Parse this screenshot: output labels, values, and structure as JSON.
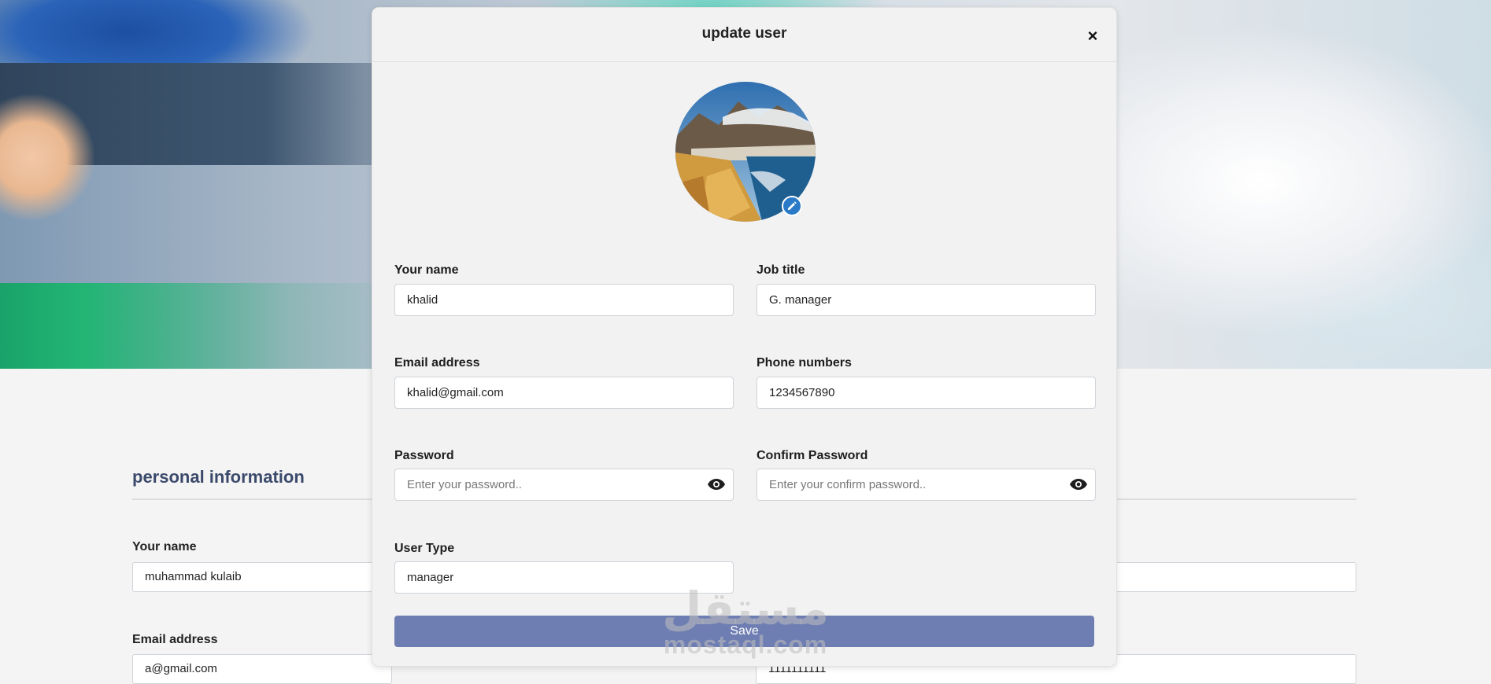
{
  "background": {
    "section_title": "personal information",
    "name_label": "Your name",
    "name_value": "muhammad kulaib",
    "email_label": "Email address",
    "email_value": "a@gmail.com",
    "phone_value": "1111111111"
  },
  "modal": {
    "title": "update user",
    "close_label": "×",
    "fields": {
      "name": {
        "label": "Your name",
        "value": "khalid"
      },
      "job_title": {
        "label": "Job title",
        "value": "G. manager"
      },
      "email": {
        "label": "Email address",
        "value": "khalid@gmail.com"
      },
      "phone": {
        "label": "Phone numbers",
        "value": "1234567890"
      },
      "password": {
        "label": "Password",
        "placeholder": "Enter your password.."
      },
      "confirm_password": {
        "label": "Confirm Password",
        "placeholder": "Enter your confirm password.."
      },
      "user_type": {
        "label": "User Type",
        "value": "manager"
      }
    },
    "save_label": "Save"
  },
  "watermark": {
    "latin": "mostaql.com",
    "arabic": "مستقل"
  },
  "icons": {
    "close": "close-icon",
    "edit": "pencil-icon",
    "password_toggle": "eye-icon"
  },
  "colors": {
    "accent": "#6f7eb2",
    "edit_badge": "#2a7ac8",
    "section_title": "#3b4a6b"
  }
}
